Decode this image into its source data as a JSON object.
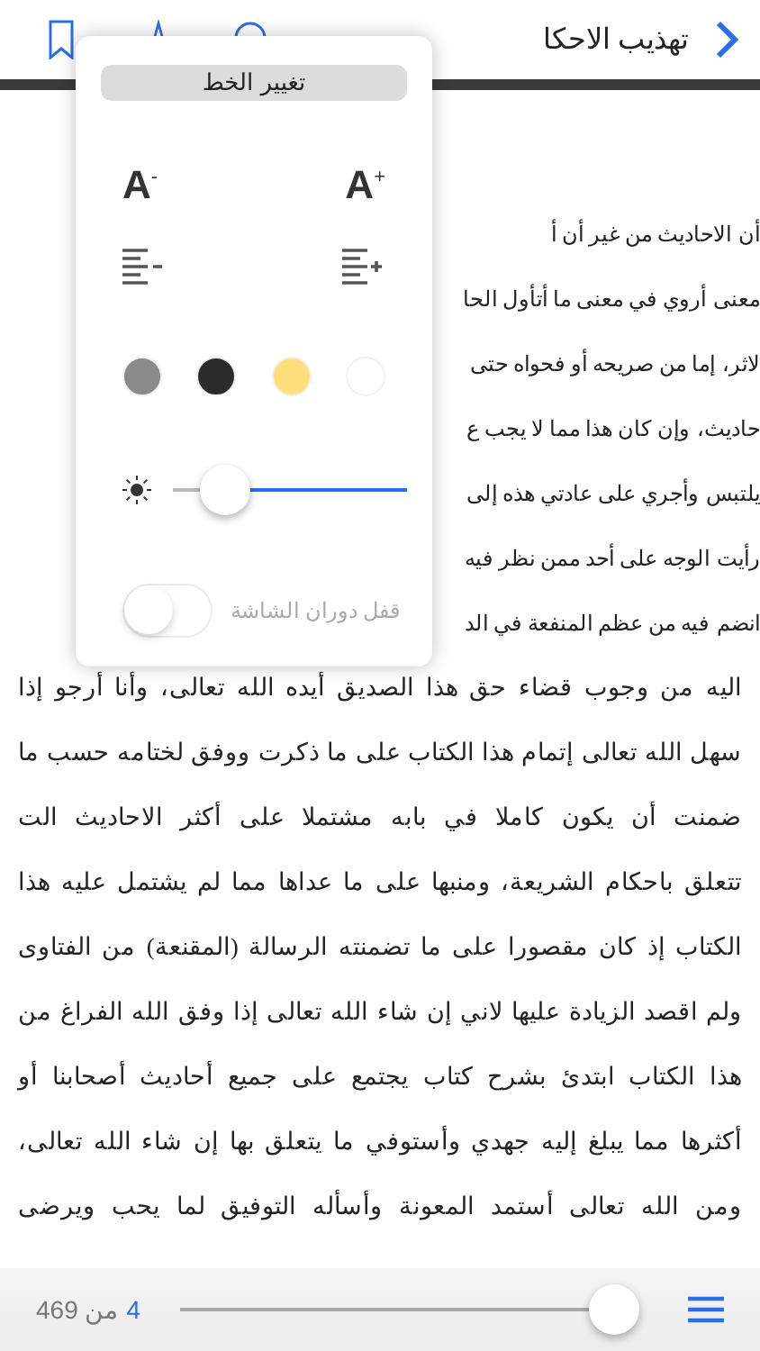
{
  "header": {
    "title": "تهذيب الاحكا"
  },
  "font_popover": {
    "font_button": "تغيير الخط",
    "font_smaller": "A$^{-}$",
    "font_larger": "A$^{+}$",
    "themes": [
      {
        "color": "#8a8a8a"
      },
      {
        "color": "#2b2b2b"
      },
      {
        "color": "#fde07c"
      },
      {
        "color": "#ffffff"
      }
    ],
    "brightness": {
      "level": 0.22
    },
    "rotation_lock": {
      "label": "قفل دوران الشاشة",
      "on": false,
      "disabled": true
    }
  },
  "page_lines": [
    {
      "text": "الاحاديث من غير أن أ",
      "edge": "أن"
    },
    {
      "text": "أروي في معنى ما أتأول الحا",
      "edge": "معنى"
    },
    {
      "text": "إما من صريحه أو فحواه حتى",
      "edge": "لاثر،"
    },
    {
      "text": "وإن كان هذا مما لا يجب ع",
      "edge": "حاديث،"
    },
    {
      "text": "وأجري على عادتي هذه إلى",
      "edge": "يلتبس"
    },
    {
      "text": "الوجه على أحد ممن نظر فيه",
      "edge": "رأيت"
    },
    {
      "text": "فيه من عظم المنفعة في الد",
      "edge": "انضم"
    },
    {
      "text": "اليه من وجوب قضاء حق هذا الصديق أيده الله تعالى، وأنا أرجو إذا"
    },
    {
      "text": "سهل الله تعالى إتمام هذا الكتاب على ما ذكرت ووفق لختامه حسب ما"
    },
    {
      "text": "ضمنت أن يكون كاملا في بابه مشتملا على أكثر الاحاديث الت"
    },
    {
      "text": "تتعلق باحكام الشريعة، ومنبها على ما عداها مما لم يشتمل عليه هذا"
    },
    {
      "text": "الكتاب إذ كان مقصورا على ما تضمنته الرسالة (المقنعة) من الفتاوى"
    },
    {
      "text": "ولم اقصد الزيادة عليها لاني إن شاء الله تعالى إذا وفق الله الفراغ من"
    },
    {
      "text": "هذا الكتاب ابتدئ بشرح كتاب يجتمع على جميع أحاديث أصحابنا أو"
    },
    {
      "text": "أكثرها مما يبلغ إليه جهدي وأستوفي ما يتعلق بها إن شاء الله تعالى،"
    },
    {
      "text": "ومن الله تعالى أستمد المعونة وأسأله التوفيق لما يحب ويرضى"
    }
  ],
  "footer": {
    "current_page": "4",
    "of_label": "من 469",
    "progress": {
      "level": 0.95
    }
  }
}
